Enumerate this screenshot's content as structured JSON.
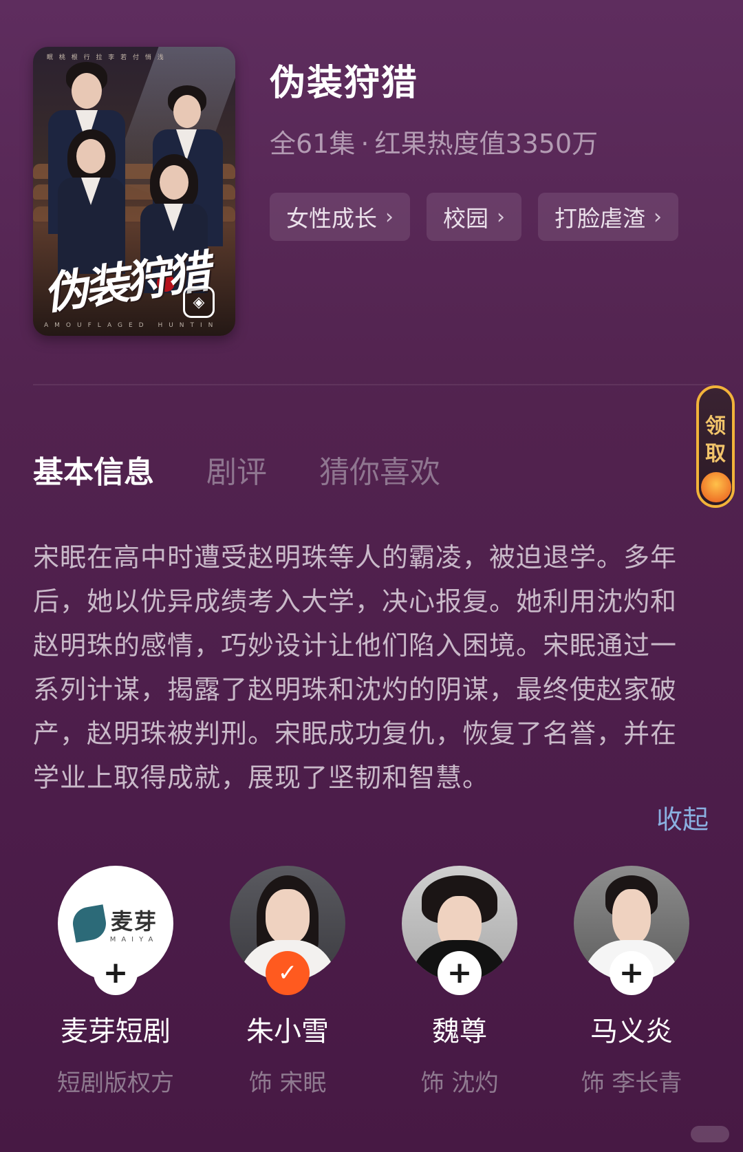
{
  "drama": {
    "title": "伪装狩猎",
    "episodes": "全61集",
    "separator": "·",
    "heat": "红果热度值3350万",
    "cover": {
      "title_art": "伪装狩猎",
      "top_text": "眠 桃 根 行 拉  李 若 付 悄 浅",
      "en_text": "AMOUFLAGED HUNTIN"
    },
    "tags": [
      {
        "label": "女性成长",
        "icon": "chevron-right-icon"
      },
      {
        "label": "校园",
        "icon": "chevron-right-icon"
      },
      {
        "label": "打脸虐渣",
        "icon": "chevron-right-icon"
      }
    ]
  },
  "float_gift": {
    "label_1": "领",
    "label_2": "取",
    "icon": "red-envelope-icon",
    "accent": "#f2b33a"
  },
  "tabs": [
    {
      "label": "基本信息",
      "active": true
    },
    {
      "label": "剧评",
      "active": false
    },
    {
      "label": "猜你喜欢",
      "active": false
    }
  ],
  "description": "宋眠在高中时遭受赵明珠等人的霸凌，被迫退学。多年后，她以优异成绩考入大学，决心报复。她利用沈灼和赵明珠的感情，巧妙设计让他们陷入困境。宋眠通过一系列计谋，揭露了赵明珠和沈灼的阴谋，最终使赵家破产，赵明珠被判刑。宋眠成功复仇，恢复了名誉，并在学业上取得成就，展现了坚韧和智慧。",
  "collapse_label": "收起",
  "cast": [
    {
      "name": "麦芽短剧",
      "role": "短剧版权方",
      "badge": "+",
      "followed": false,
      "logo_cn": "麦芽",
      "logo_en": "MAIYA"
    },
    {
      "name": "朱小雪",
      "role": "饰 宋眠",
      "badge": "✓",
      "followed": true
    },
    {
      "name": "魏尊",
      "role": "饰 沈灼",
      "badge": "+",
      "followed": false
    },
    {
      "name": "马义炎",
      "role": "饰 李长青",
      "badge": "+",
      "followed": false
    }
  ],
  "colors": {
    "follow_active": "#ff5a1f",
    "link": "#8ab0e0",
    "background": "#52234f"
  }
}
